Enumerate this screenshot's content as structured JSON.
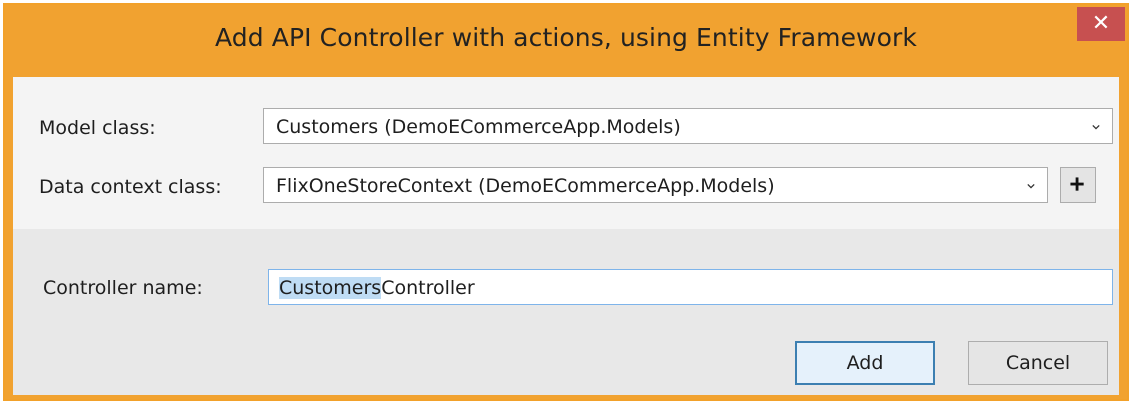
{
  "window": {
    "title": "Add API Controller with actions, using Entity Framework",
    "close_glyph": "✕",
    "accent_color": "#f1a230"
  },
  "form": {
    "model_class": {
      "label": "Model class:",
      "value": "Customers (DemoECommerceApp.Models)"
    },
    "data_context_class": {
      "label": "Data context class:",
      "value": "FlixOneStoreContext (DemoECommerceApp.Models)",
      "add_icon": "plus-icon"
    },
    "controller_name": {
      "label": "Controller name:",
      "selected_part": "Customers",
      "rest_part": "Controller"
    }
  },
  "buttons": {
    "add": "Add",
    "cancel": "Cancel"
  }
}
